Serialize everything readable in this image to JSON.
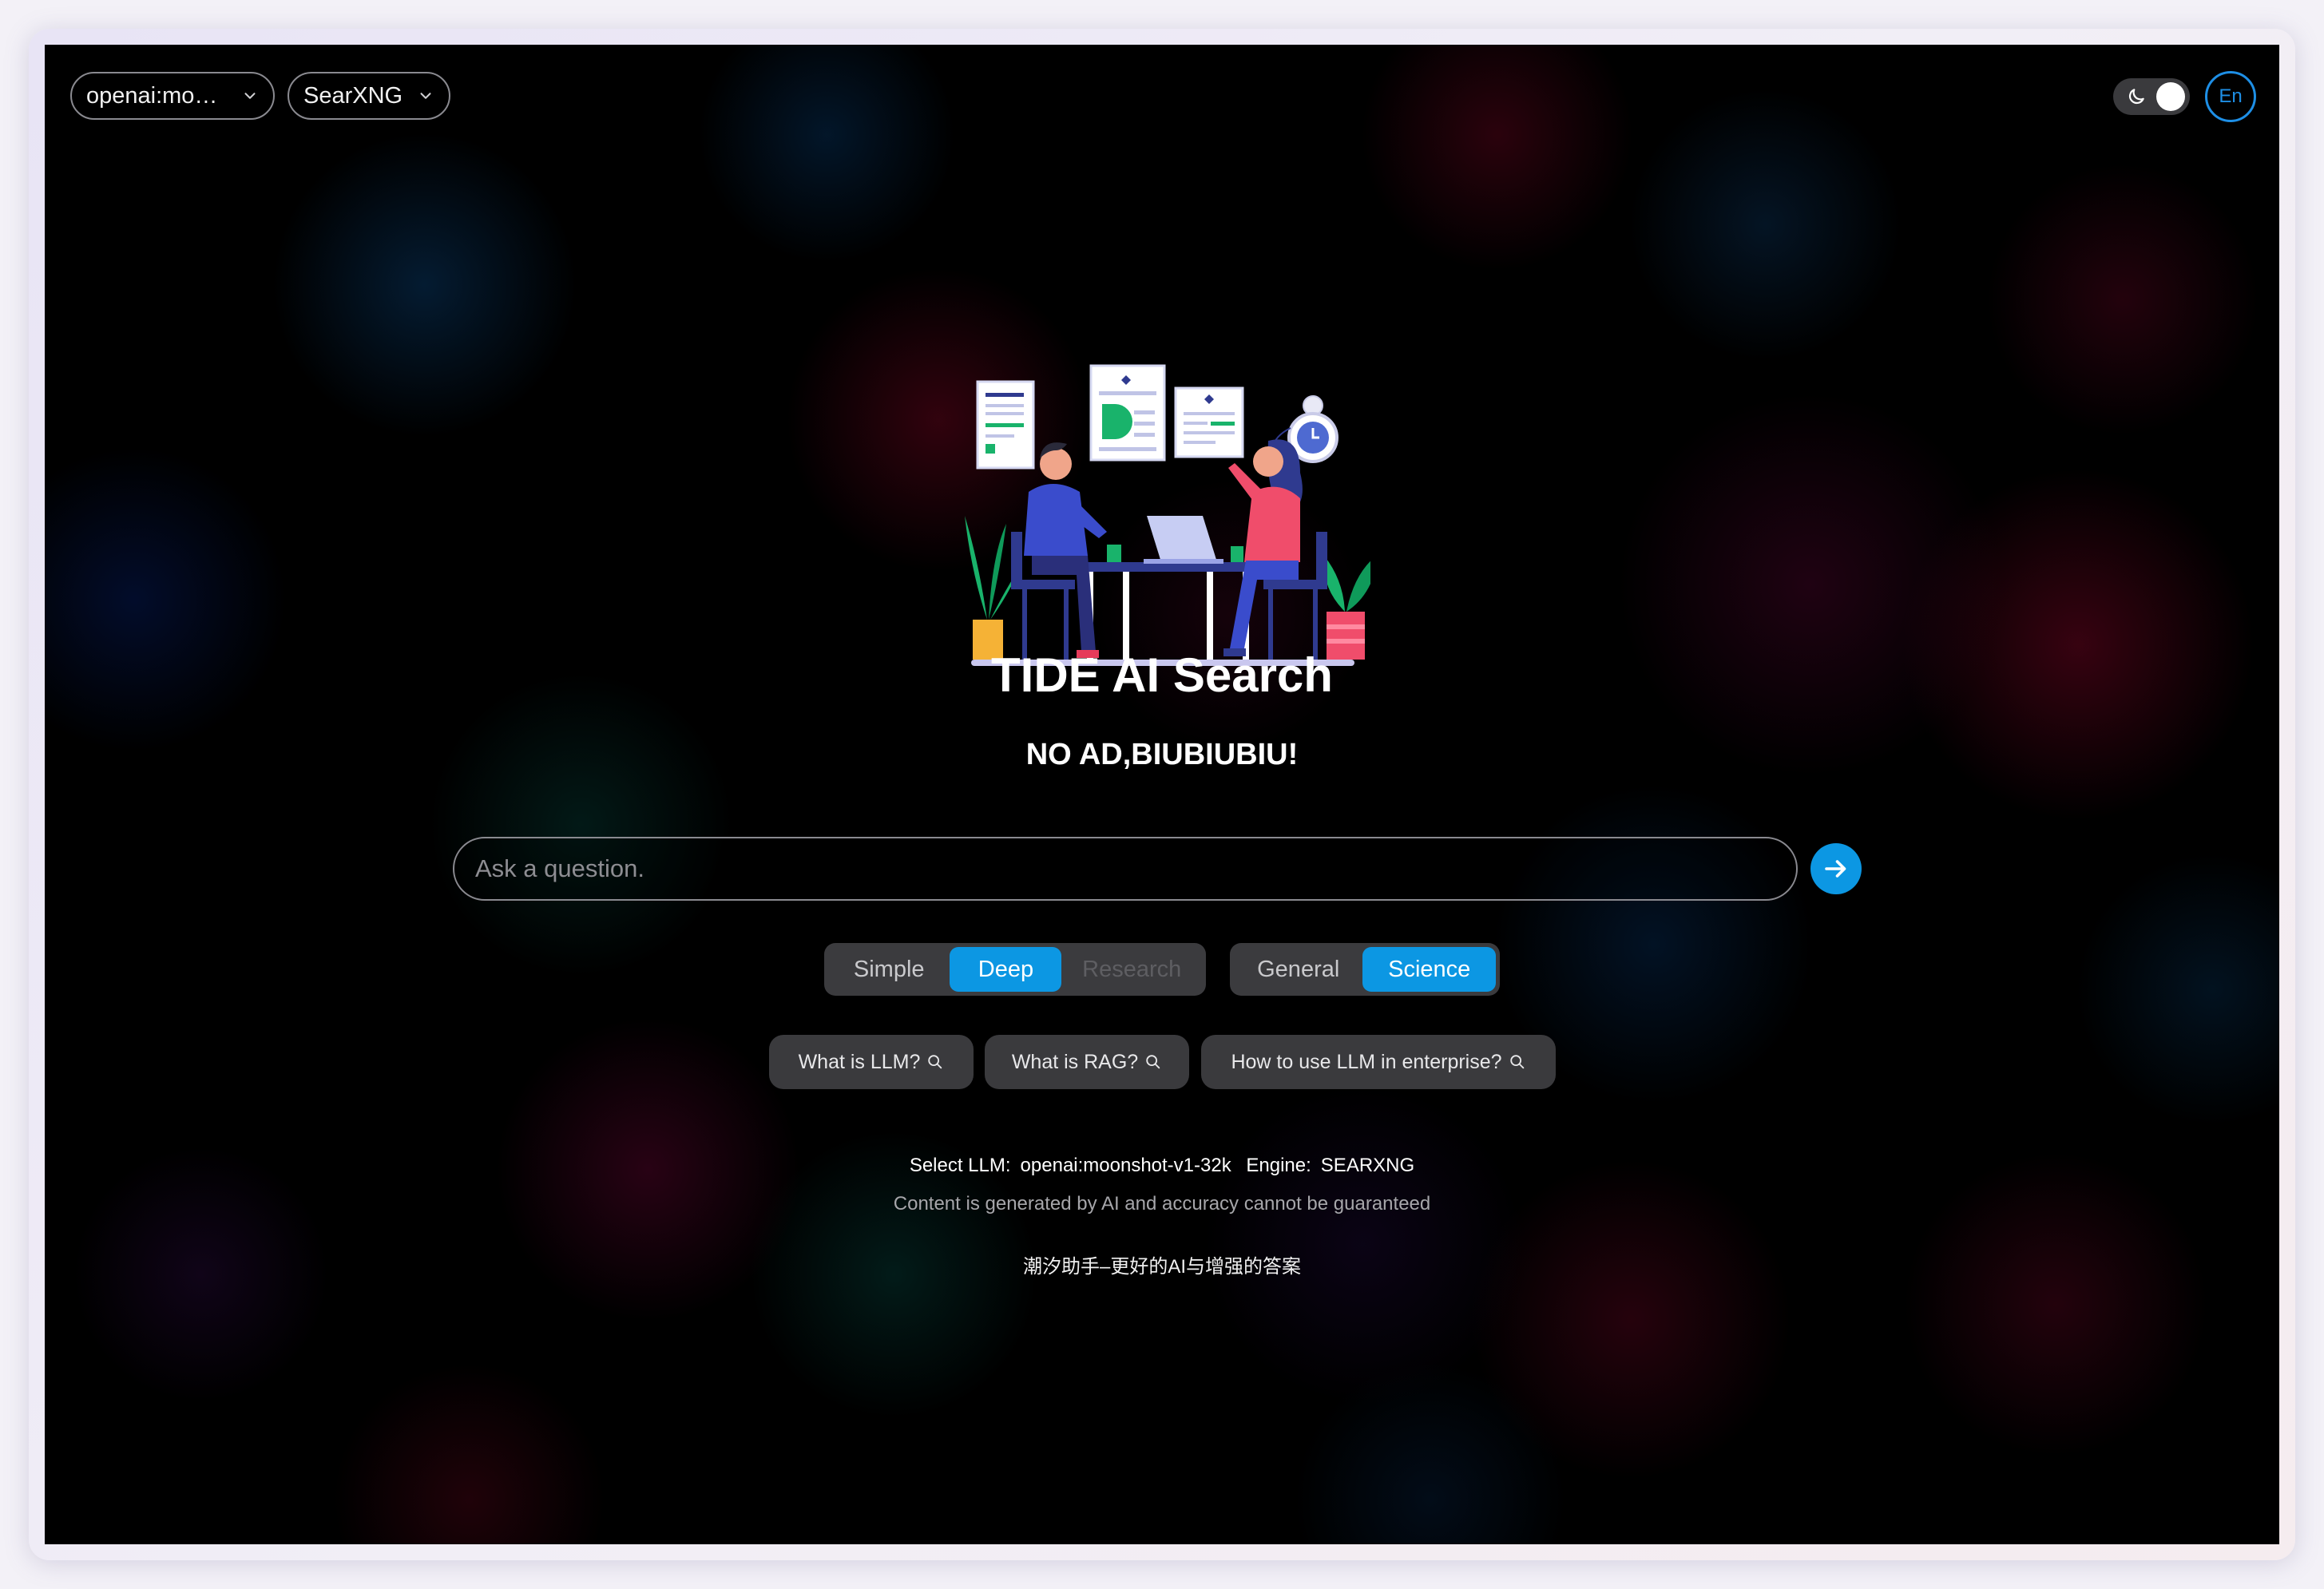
{
  "topbar": {
    "llm_select_value": "openai:mo…",
    "engine_select_value": "SearXNG",
    "language_label": "En",
    "theme_icon": "moon-icon"
  },
  "hero": {
    "title": "TIDE AI Search",
    "subtitle": "NO AD,BIUBIUBIU!"
  },
  "search": {
    "placeholder": "Ask a question.",
    "value": "",
    "submit_icon": "arrow-right-icon"
  },
  "mode_tabs": {
    "items": [
      "Simple",
      "Deep",
      "Research"
    ],
    "selected": "Deep",
    "disabled": [
      "Research"
    ]
  },
  "category_tabs": {
    "items": [
      "General",
      "Science"
    ],
    "selected": "Science"
  },
  "suggestions": [
    "What is LLM?",
    "What is RAG?",
    "How to use LLM in enterprise?"
  ],
  "footer": {
    "llm_label": "Select LLM:",
    "llm_value": "openai:moonshot-v1-32k",
    "engine_label": "Engine:",
    "engine_value": "SEARXNG",
    "disclaimer": "Content is generated by AI and accuracy cannot be guaranteed",
    "tagline": "潮汐助手–更好的AI与增强的答案"
  },
  "colors": {
    "accent": "#0c97e3",
    "background": "#000000",
    "chip": "#3a3a3d"
  }
}
